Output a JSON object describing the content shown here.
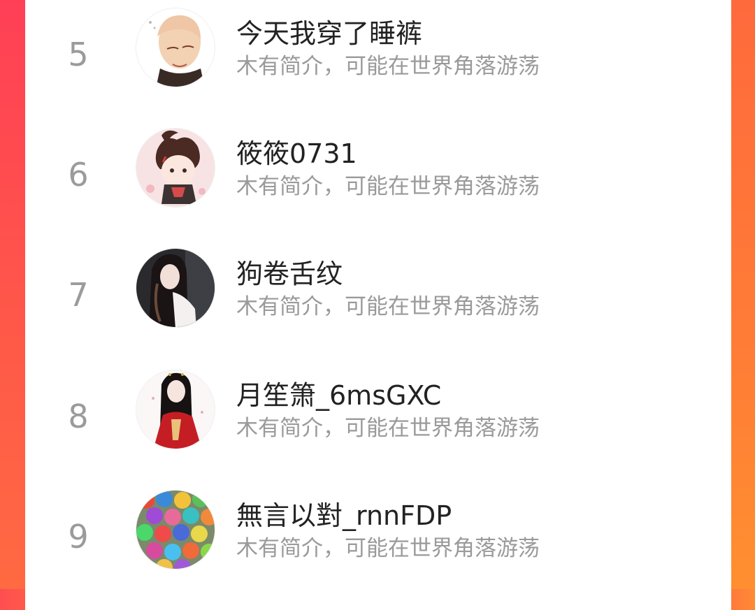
{
  "theme": {
    "accent_left": "#ff4d52",
    "accent_right": "#ff8a34",
    "rank_color": "#9b9b9b",
    "name_color": "#222222",
    "bio_color": "#9a9a9a"
  },
  "ranking_list": {
    "items": [
      {
        "rank": "5",
        "name": "今天我穿了睡裤",
        "bio": "木有简介，可能在世界角落游荡",
        "avatar_icon": "bald-man-avatar-icon"
      },
      {
        "rank": "6",
        "name": "筱筱0731",
        "bio": "木有简介，可能在世界角落游荡",
        "avatar_icon": "anime-girl-avatar-icon"
      },
      {
        "rank": "7",
        "name": "狗卷舌纹",
        "bio": "木有简介，可能在世界角落游荡",
        "avatar_icon": "long-hair-girl-avatar-icon"
      },
      {
        "rank": "8",
        "name": "月笙箫_6msGXC",
        "bio": "木有简介，可能在世界角落游荡",
        "avatar_icon": "red-dress-girl-avatar-icon"
      },
      {
        "rank": "9",
        "name": "無言以對_rnnFDP",
        "bio": "木有简介，可能在世界角落游荡",
        "avatar_icon": "umbrellas-avatar-icon"
      }
    ]
  }
}
